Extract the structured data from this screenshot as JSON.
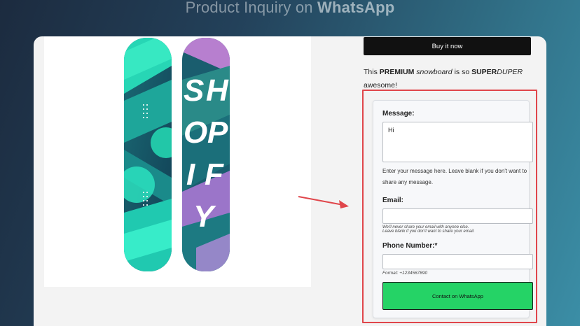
{
  "header": {
    "title_prefix": "Product Inquiry on",
    "title_brand": "WhatsApp"
  },
  "product": {
    "buy_button_label": "Buy it now",
    "description": {
      "part1": "This",
      "premium": "PREMIUM",
      "snowboard": "snowboard",
      "part2": "is so",
      "super": "SUPER",
      "duper": "DUPER",
      "part3": "awesome!"
    },
    "board_graphic_text": "SHOPIFY"
  },
  "form": {
    "message_label": "Message:",
    "message_value": "Hi",
    "message_hint": "Enter your message here. Leave blank if you don't want to share any message.",
    "email_label": "Email:",
    "email_value": "",
    "email_hint_line1": "We'll never share your email with anyone else.",
    "email_hint_line2": "Leave blank if you don't want to share your email.",
    "phone_label": "Phone Number:*",
    "phone_value": "",
    "phone_hint": "Format: +1234567890",
    "submit_label": "Contact on WhatsApp"
  },
  "colors": {
    "whatsapp_green": "#25d366",
    "highlight_red": "#e0464b",
    "buy_button_black": "#111111"
  }
}
